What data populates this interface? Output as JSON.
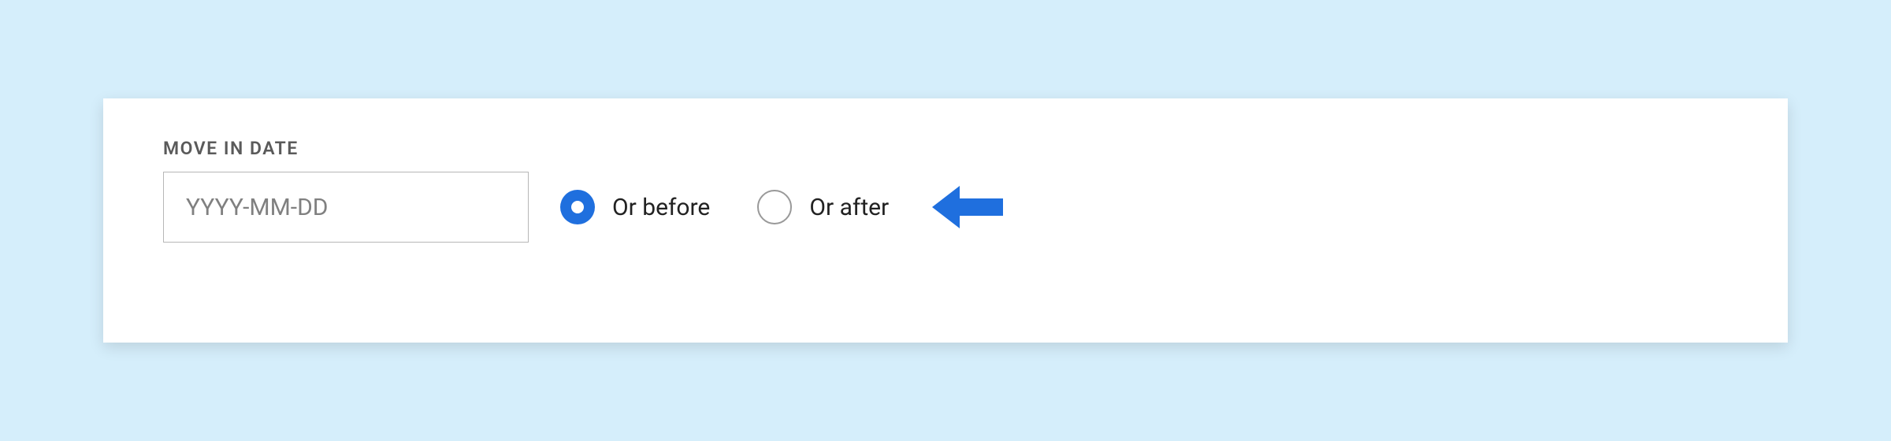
{
  "form": {
    "label": "MOVE IN DATE",
    "date_placeholder": "YYYY-MM-DD",
    "date_value": "",
    "options": {
      "before": {
        "label": "Or before",
        "selected": true
      },
      "after": {
        "label": "Or after",
        "selected": false
      }
    }
  },
  "colors": {
    "accent": "#1f6fde",
    "arrow": "#1f6fde"
  }
}
